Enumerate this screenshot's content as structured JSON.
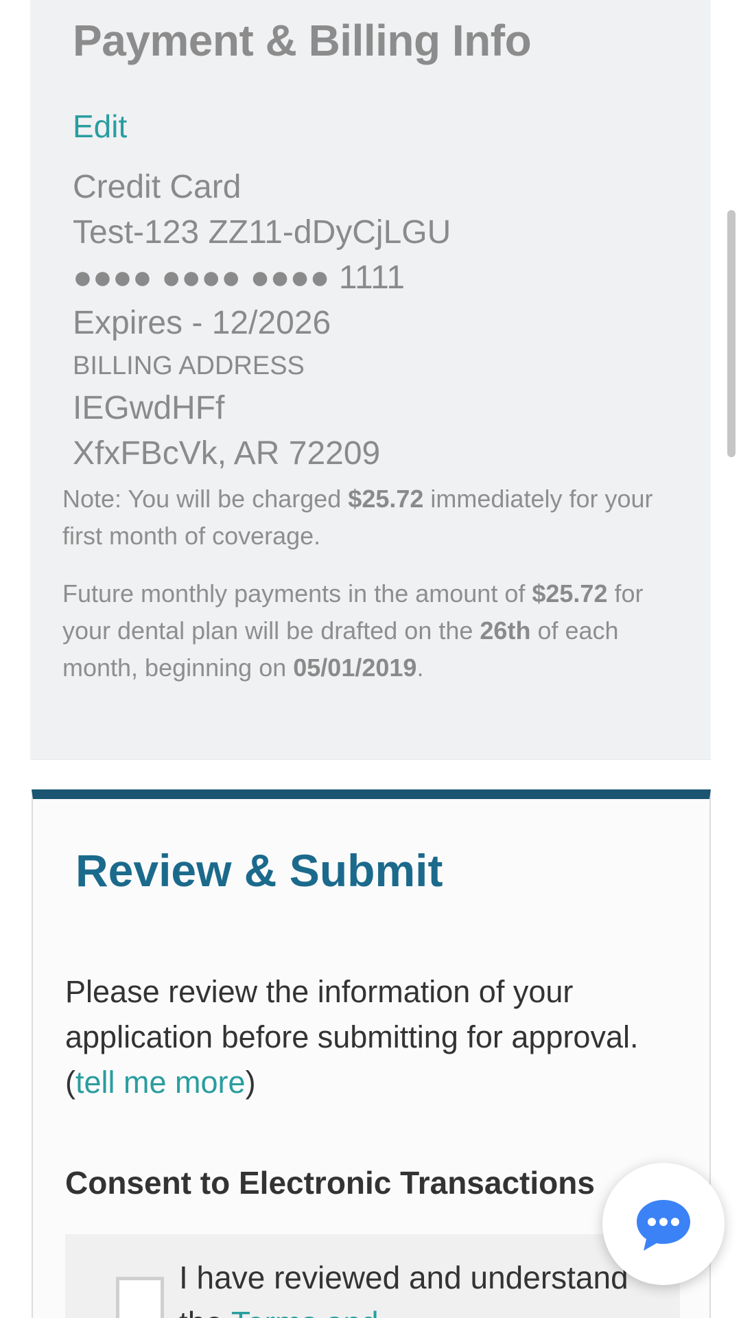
{
  "billing": {
    "title": "Payment & Billing Info",
    "edit_label": "Edit",
    "payment_type": "Credit Card",
    "card_name": "Test-123 ZZ11-dDyCjLGU",
    "card_number": "●●●● ●●●● ●●●● 1111",
    "expires": "Expires - 12/2026",
    "address_heading": "BILLING ADDRESS",
    "address_line1": "IEGwdHFf",
    "address_line2": "XfxFBcVk, AR 72209",
    "note1": {
      "prefix": "Note: You will be charged ",
      "amount": "$25.72",
      "suffix": " immediately for your first month of coverage."
    },
    "note2": {
      "prefix": "Future monthly payments in the amount of ",
      "amount": "$25.72",
      "middle1": " for your dental plan will be drafted on the ",
      "day": "26th",
      "middle2": " of each month, beginning on ",
      "date": "05/01/2019",
      "suffix": "."
    }
  },
  "review": {
    "title": "Review & Submit",
    "text": "Please review the information of your application before submitting for approval. (",
    "tell_more": "tell me more",
    "text_end": ")",
    "consent_title": "Consent to Electronic Transactions",
    "consent_text": "I have reviewed and understand the ",
    "consent_link": "Terms and"
  },
  "colors": {
    "accent": "#2a9d9f",
    "header_bar": "#1b5572",
    "review_title": "#1b6a8c",
    "chat_icon": "#3b82f6"
  },
  "icons": {
    "chat": "chat-bubble-icon"
  }
}
